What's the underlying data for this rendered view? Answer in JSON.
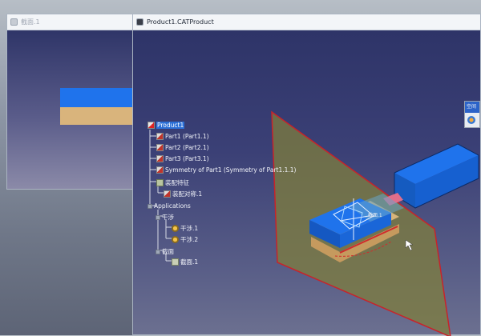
{
  "left_window": {
    "title": "截面.1"
  },
  "main_window": {
    "title": "Product1.CATProduct"
  },
  "tree": [
    {
      "id": "product",
      "label": "Product1",
      "icon": "product-icon",
      "selected": true
    },
    {
      "id": "part1",
      "label": "Part1 (Part1.1)",
      "icon": "part-icon"
    },
    {
      "id": "part2",
      "label": "Part2 (Part2.1)",
      "icon": "part-icon"
    },
    {
      "id": "part3",
      "label": "Part3 (Part3.1)",
      "icon": "part-icon"
    },
    {
      "id": "sym",
      "label": "Symmetry of Part1 (Symmetry of Part1.1.1)",
      "icon": "part-icon"
    },
    {
      "id": "asm-feat",
      "label": "装配特征",
      "icon": "constraint-icon"
    },
    {
      "id": "asm-sym",
      "label": "装配对称.1",
      "icon": "part-icon"
    },
    {
      "id": "apps",
      "label": "Applications",
      "icon": "application-icon"
    },
    {
      "id": "interf",
      "label": "干涉",
      "icon": "application-icon"
    },
    {
      "id": "interf1",
      "label": "干涉.1",
      "icon": "interference-icon"
    },
    {
      "id": "interf2",
      "label": "干涉.2",
      "icon": "interference-icon"
    },
    {
      "id": "sections",
      "label": "截面",
      "icon": "application-icon"
    },
    {
      "id": "section1",
      "label": "截面.1",
      "icon": "section-icon"
    }
  ],
  "scene": {
    "plane_label": "截面.1",
    "colors": {
      "plane": "#7a7a3a",
      "top": "#1f6ee6",
      "base": "#d4b074",
      "rim": "#d02c2c"
    }
  },
  "popup": {
    "title": "空间"
  }
}
